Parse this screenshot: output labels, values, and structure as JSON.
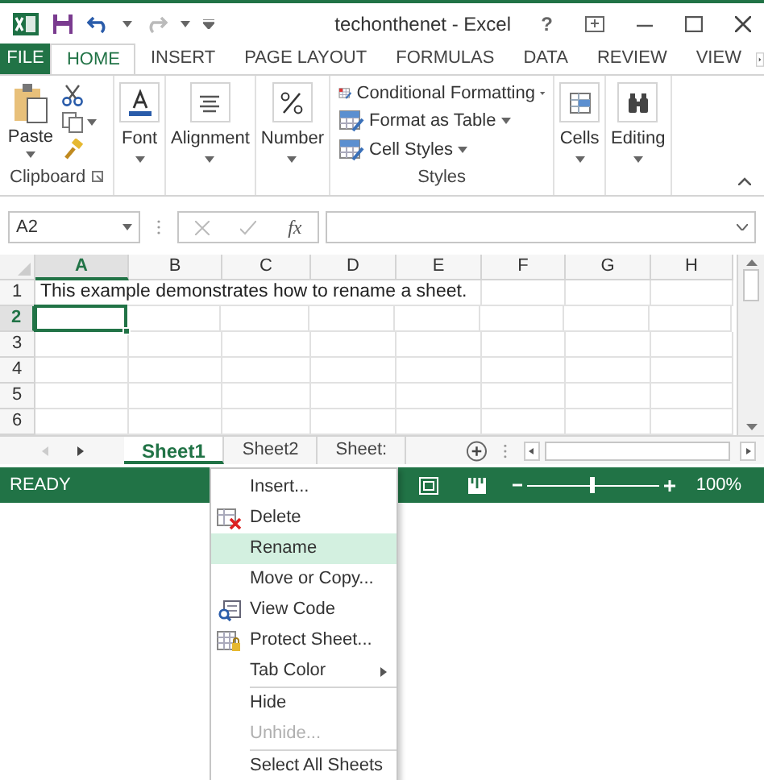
{
  "window": {
    "title": "techonthenet - Excel",
    "help": "?"
  },
  "ribbon_tabs": [
    {
      "label": "FILE",
      "kind": "file",
      "selected": false
    },
    {
      "label": "HOME",
      "kind": "tab",
      "selected": true
    },
    {
      "label": "INSERT",
      "kind": "tab",
      "selected": false
    },
    {
      "label": "PAGE LAYOUT",
      "kind": "tab",
      "selected": false
    },
    {
      "label": "FORMULAS",
      "kind": "tab",
      "selected": false
    },
    {
      "label": "DATA",
      "kind": "tab",
      "selected": false
    },
    {
      "label": "REVIEW",
      "kind": "tab",
      "selected": false
    },
    {
      "label": "VIEW",
      "kind": "tab",
      "selected": false
    }
  ],
  "ribbon_groups": [
    {
      "kind": "clipboard",
      "label": "Paste",
      "group_label": "Clipboard"
    },
    {
      "kind": "collapsed",
      "label": "Font"
    },
    {
      "kind": "collapsed",
      "label": "Alignment"
    },
    {
      "kind": "collapsed",
      "label": "Number"
    },
    {
      "kind": "styles",
      "items": [
        "Conditional Formatting",
        "Format as Table",
        "Cell Styles"
      ],
      "group_label": "Styles"
    },
    {
      "kind": "collapsed",
      "label": "Cells"
    },
    {
      "kind": "collapsed",
      "label": "Editing"
    }
  ],
  "formula_bar": {
    "name_box": "A2",
    "fx": "fx"
  },
  "grid": {
    "columns": [
      {
        "label": "A",
        "selected": true
      },
      {
        "label": "B",
        "selected": false
      },
      {
        "label": "C",
        "selected": false
      },
      {
        "label": "D",
        "selected": false
      },
      {
        "label": "E",
        "selected": false
      },
      {
        "label": "F",
        "selected": false
      },
      {
        "label": "G",
        "selected": false
      },
      {
        "label": "H",
        "selected": false
      }
    ],
    "rows": [
      {
        "label": "1",
        "selected": false,
        "text": "This example demonstrates how to rename a sheet."
      },
      {
        "label": "2",
        "selected": true
      },
      {
        "label": "3",
        "selected": false
      },
      {
        "label": "4",
        "selected": false
      },
      {
        "label": "5",
        "selected": false
      },
      {
        "label": "6",
        "selected": false
      }
    ]
  },
  "sheet_tabs": [
    {
      "label": "Sheet1",
      "selected": true
    },
    {
      "label": "Sheet2",
      "selected": false
    },
    {
      "label": "Sheet:",
      "selected": false
    }
  ],
  "status_bar": {
    "status": "READY",
    "zoom": "100%",
    "level": 0.5
  },
  "context_menu": [
    {
      "label": "Insert...",
      "disabled": false,
      "selected": false
    },
    {
      "label": "Delete",
      "disabled": false,
      "selected": false
    },
    {
      "label": "Rename",
      "disabled": false,
      "selected": true
    },
    {
      "label": "Move or Copy...",
      "disabled": false,
      "selected": false
    },
    {
      "label": "View Code",
      "disabled": false,
      "selected": false
    },
    {
      "label": "Protect Sheet...",
      "disabled": false,
      "selected": false
    },
    {
      "label": "Tab Color",
      "disabled": false,
      "selected": false,
      "submenu": true,
      "separator_after": true
    },
    {
      "label": "Hide",
      "disabled": false,
      "selected": false
    },
    {
      "label": "Unhide...",
      "disabled": true,
      "selected": false,
      "separator_after": true
    },
    {
      "label": "Select All Sheets",
      "disabled": false,
      "selected": false
    }
  ]
}
